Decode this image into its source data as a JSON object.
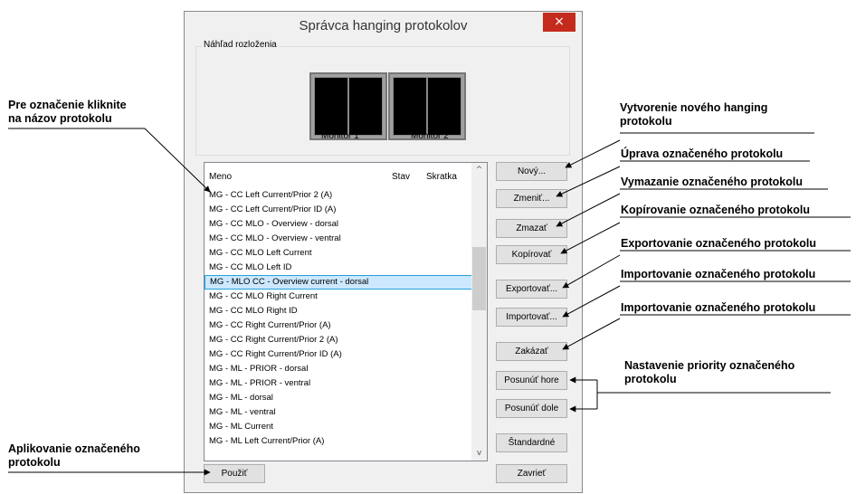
{
  "window": {
    "title": "Správca hanging protokolov",
    "close_glyph": "×"
  },
  "preview": {
    "label": "Náhľad rozloženia",
    "monitor1": "Monitor 1",
    "monitor2": "Monitor 2"
  },
  "list": {
    "headers": {
      "name": "Meno",
      "status": "Stav",
      "shortcut": "Skratka"
    },
    "rows": [
      "MG - CC Left Current/Prior 2 (A)",
      "MG - CC Left Current/Prior ID (A)",
      "MG - CC MLO - Overview - dorsal",
      "MG - CC MLO - Overview - ventral",
      "MG - CC MLO Left Current",
      "MG - CC MLO Left ID",
      "MG - MLO CC - Overview current - dorsal",
      "MG - CC MLO Right Current",
      "MG - CC MLO Right ID",
      "MG - CC Right Current/Prior (A)",
      "MG - CC Right Current/Prior 2 (A)",
      "MG - CC Right Current/Prior ID (A)",
      "MG - ML - PRIOR - dorsal",
      "MG - ML - PRIOR - ventral",
      "MG - ML - dorsal",
      "MG - ML - ventral",
      "MG - ML Current",
      "MG - ML Left Current/Prior (A)"
    ],
    "selected_index": 6,
    "scroll_up": "^",
    "scroll_down": "v"
  },
  "buttons": {
    "new": "Nový...",
    "edit": "Zmeniť...",
    "delete": "Zmazať",
    "copy": "Kopírovať",
    "export": "Exportovať...",
    "import": "Importovať...",
    "disable": "Zakázať",
    "move_up": "Posunúť hore",
    "move_down": "Posunúť dole",
    "default": "Štandardné",
    "apply": "Použiť",
    "close": "Zavrieť"
  },
  "annotations": {
    "click_name": [
      "Pre označenie kliknite",
      "na názov protokolu"
    ],
    "apply": [
      "Aplikovanie označeného",
      "protokolu"
    ],
    "new": [
      "Vytvorenie nového hanging",
      "protokolu"
    ],
    "edit": "Úprava označeného protokolu",
    "delete": "Vymazanie označeného protokolu",
    "copy": "Kopírovanie označeného protokolu",
    "export": "Exportovanie označeného protokolu",
    "import1": "Importovanie označeného protokolu",
    "import2": "Importovanie označeného protokolu",
    "priority": [
      "Nastavenie priority označeného",
      "protokolu"
    ]
  }
}
